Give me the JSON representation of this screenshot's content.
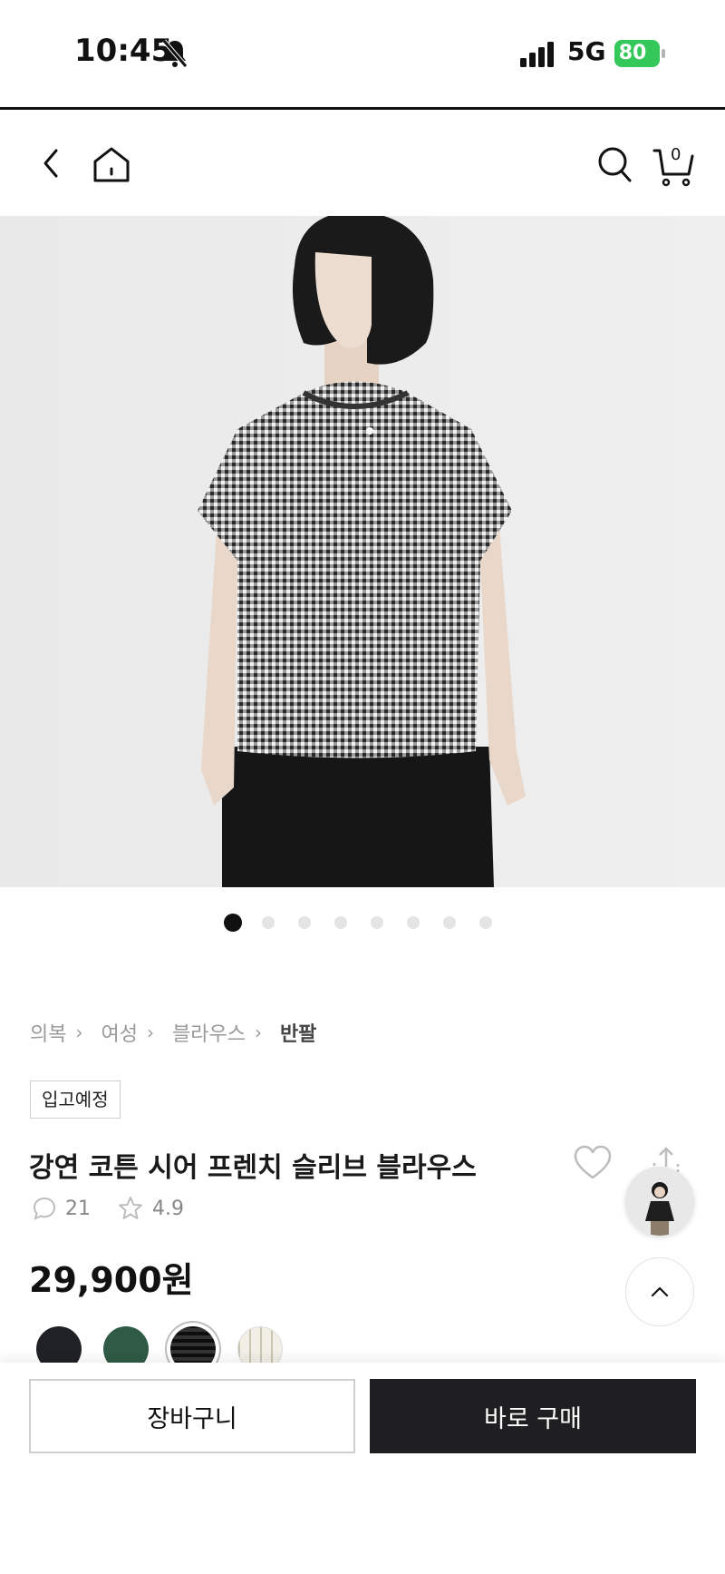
{
  "status_bar": {
    "time": "10:45",
    "network": "5G",
    "battery": "80"
  },
  "nav": {
    "cart_count": "0"
  },
  "carousel": {
    "total": 8,
    "active_index": 0
  },
  "breadcrumb": [
    "의복",
    "여성",
    "블라우스",
    "반팔"
  ],
  "badge": "입고예정",
  "product": {
    "title": "강연 코튼 시어 프렌치 슬리브 블라우스",
    "reviews": "21",
    "rating": "4.9",
    "price": "29,900원"
  },
  "swatches": [
    {
      "name": "black",
      "color": "#1f2126"
    },
    {
      "name": "green",
      "color": "#2f5a45"
    },
    {
      "name": "gingham",
      "color": "#3a3a3a",
      "selected": true
    },
    {
      "name": "check",
      "color": "#e6e4d8"
    }
  ],
  "actions": {
    "cart_button": "장바구니",
    "buy_button": "바로 구매"
  },
  "colors": {
    "primary": "#1f1f21",
    "battery": "#34c759"
  }
}
